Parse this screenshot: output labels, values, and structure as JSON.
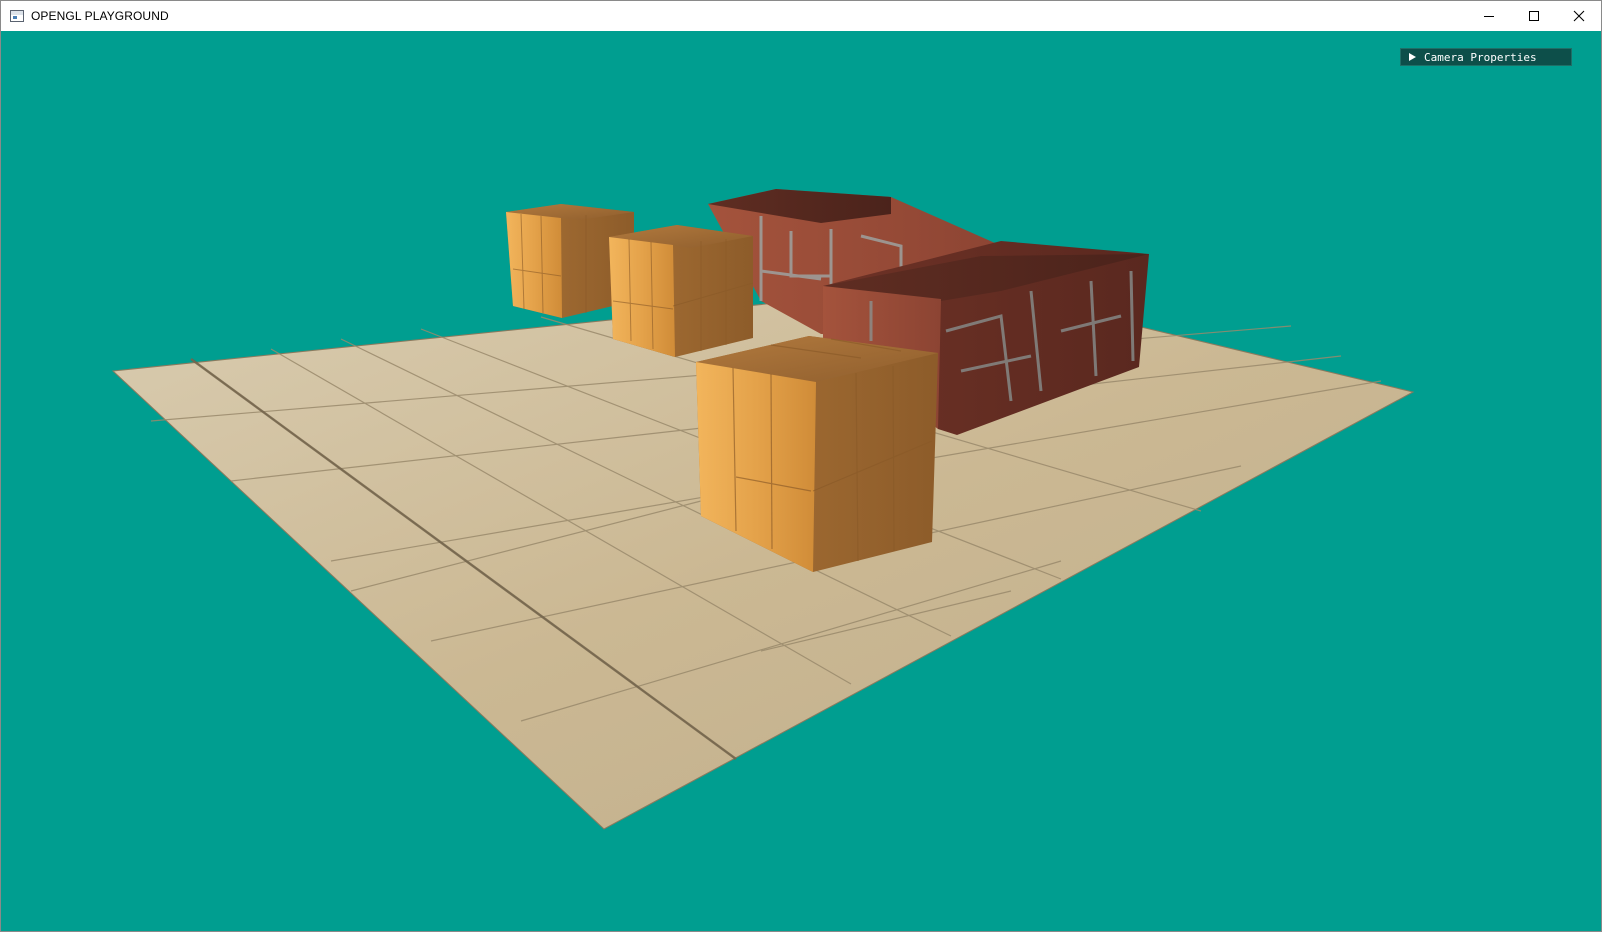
{
  "window": {
    "title": "OPENGL PLAYGROUND",
    "controls": {
      "minimize_icon": "minimize-icon",
      "maximize_icon": "maximize-icon",
      "close_icon": "close-icon"
    }
  },
  "scene": {
    "background_color": "#009e90",
    "floor_material": "stone-tiles",
    "objects": [
      {
        "name": "wooden-crate-back",
        "material": "wood"
      },
      {
        "name": "wooden-crate-middle",
        "material": "wood"
      },
      {
        "name": "wooden-crate-front",
        "material": "wood"
      },
      {
        "name": "brick-wall-back",
        "material": "brick"
      },
      {
        "name": "brick-wall-front",
        "material": "brick"
      }
    ]
  },
  "panel": {
    "camera_properties_label": "Camera Properties",
    "collapsed": true
  }
}
